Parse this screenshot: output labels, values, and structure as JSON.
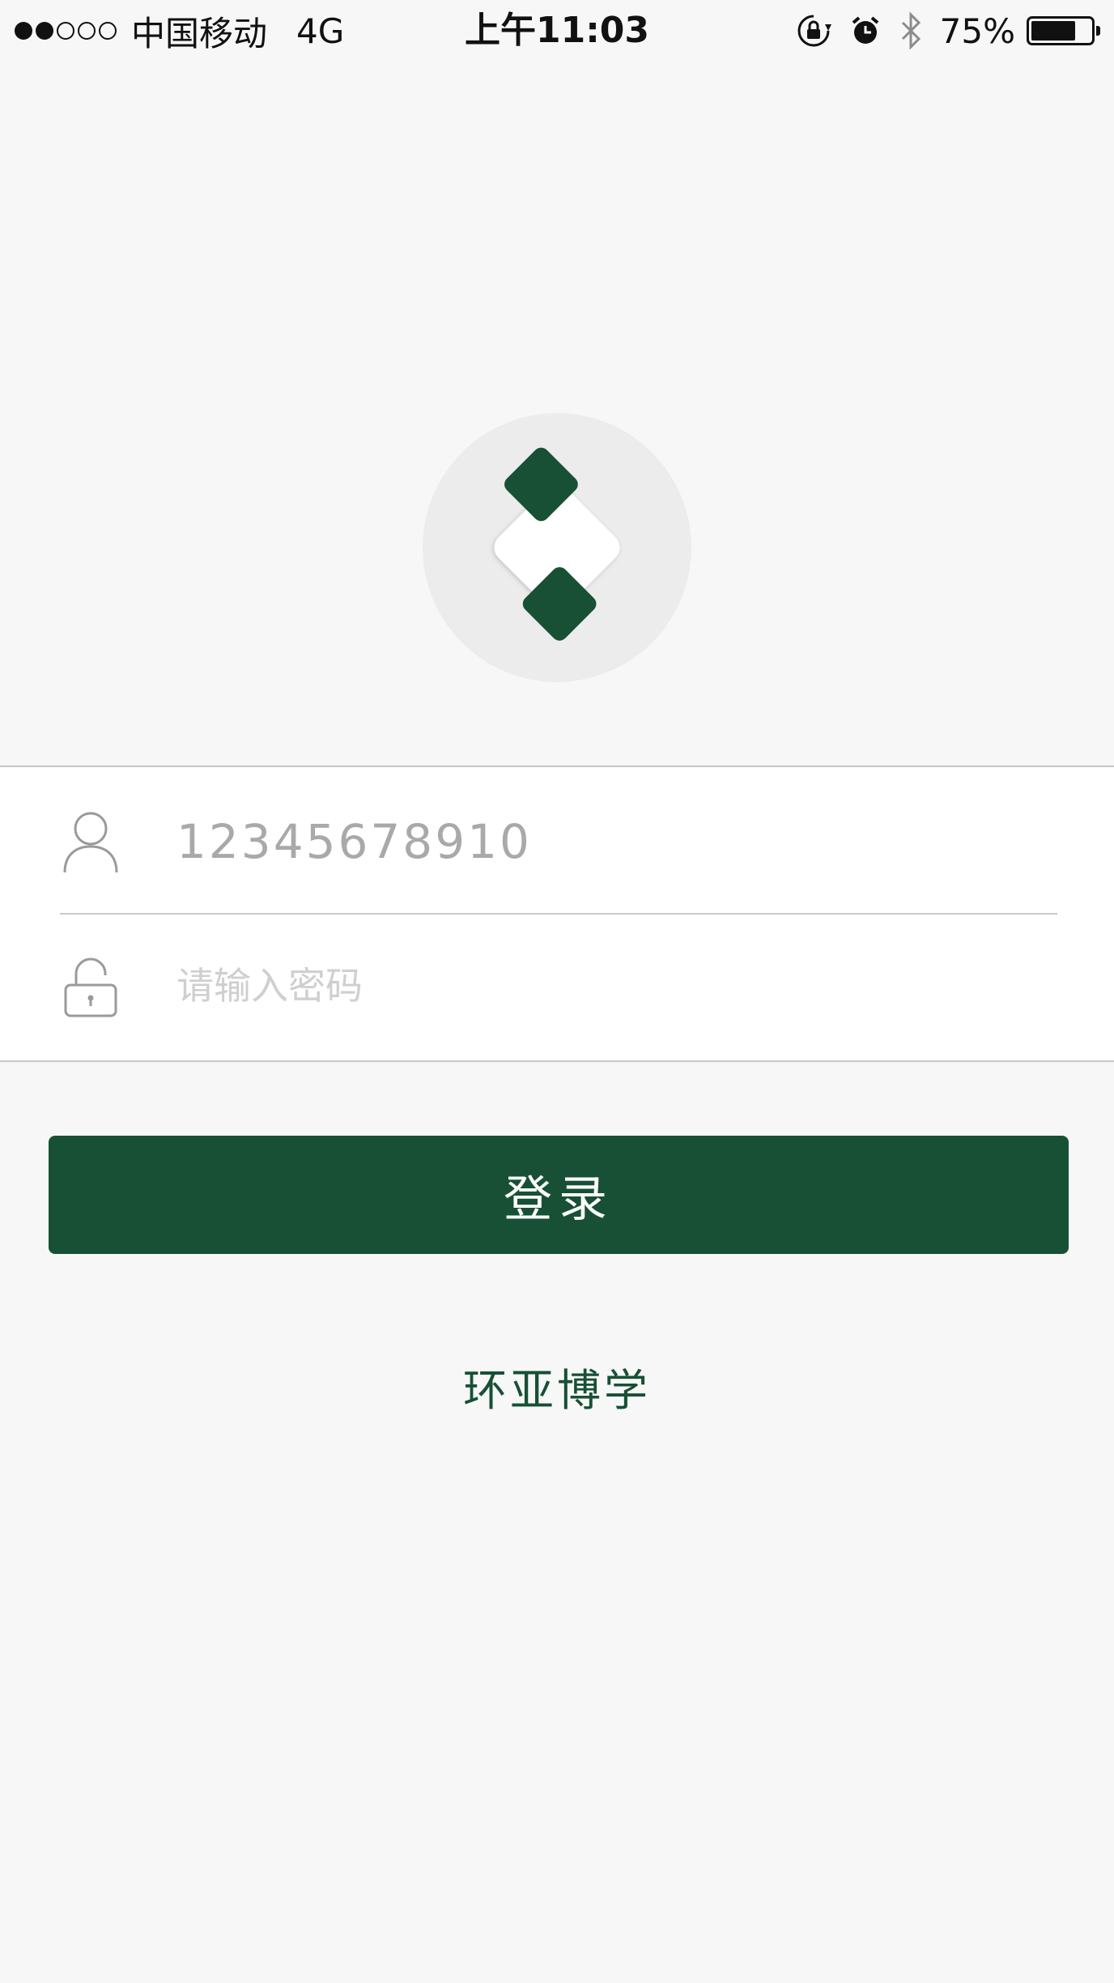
{
  "status_bar": {
    "carrier": "中国移动",
    "network": "4G",
    "time": "上午11:03",
    "battery_level": "75%",
    "signal_bars_filled": 2,
    "signal_bars_total": 5,
    "icons": [
      "orientation-lock-icon",
      "alarm-icon",
      "bluetooth-icon",
      "battery-icon"
    ]
  },
  "logo": {
    "icon": "app-logo-diamond-icon",
    "accent_color": "#175035"
  },
  "login_form": {
    "username": {
      "icon": "user-icon",
      "value": "12345678910"
    },
    "password": {
      "icon": "lock-icon",
      "placeholder": "请输入密码",
      "value": ""
    }
  },
  "login_button": {
    "label": "登录"
  },
  "brand": {
    "name": "环亚博学"
  },
  "colors": {
    "primary": "#175035",
    "background": "#f7f7f7",
    "card": "#ffffff",
    "divider": "#c8c8c8"
  }
}
